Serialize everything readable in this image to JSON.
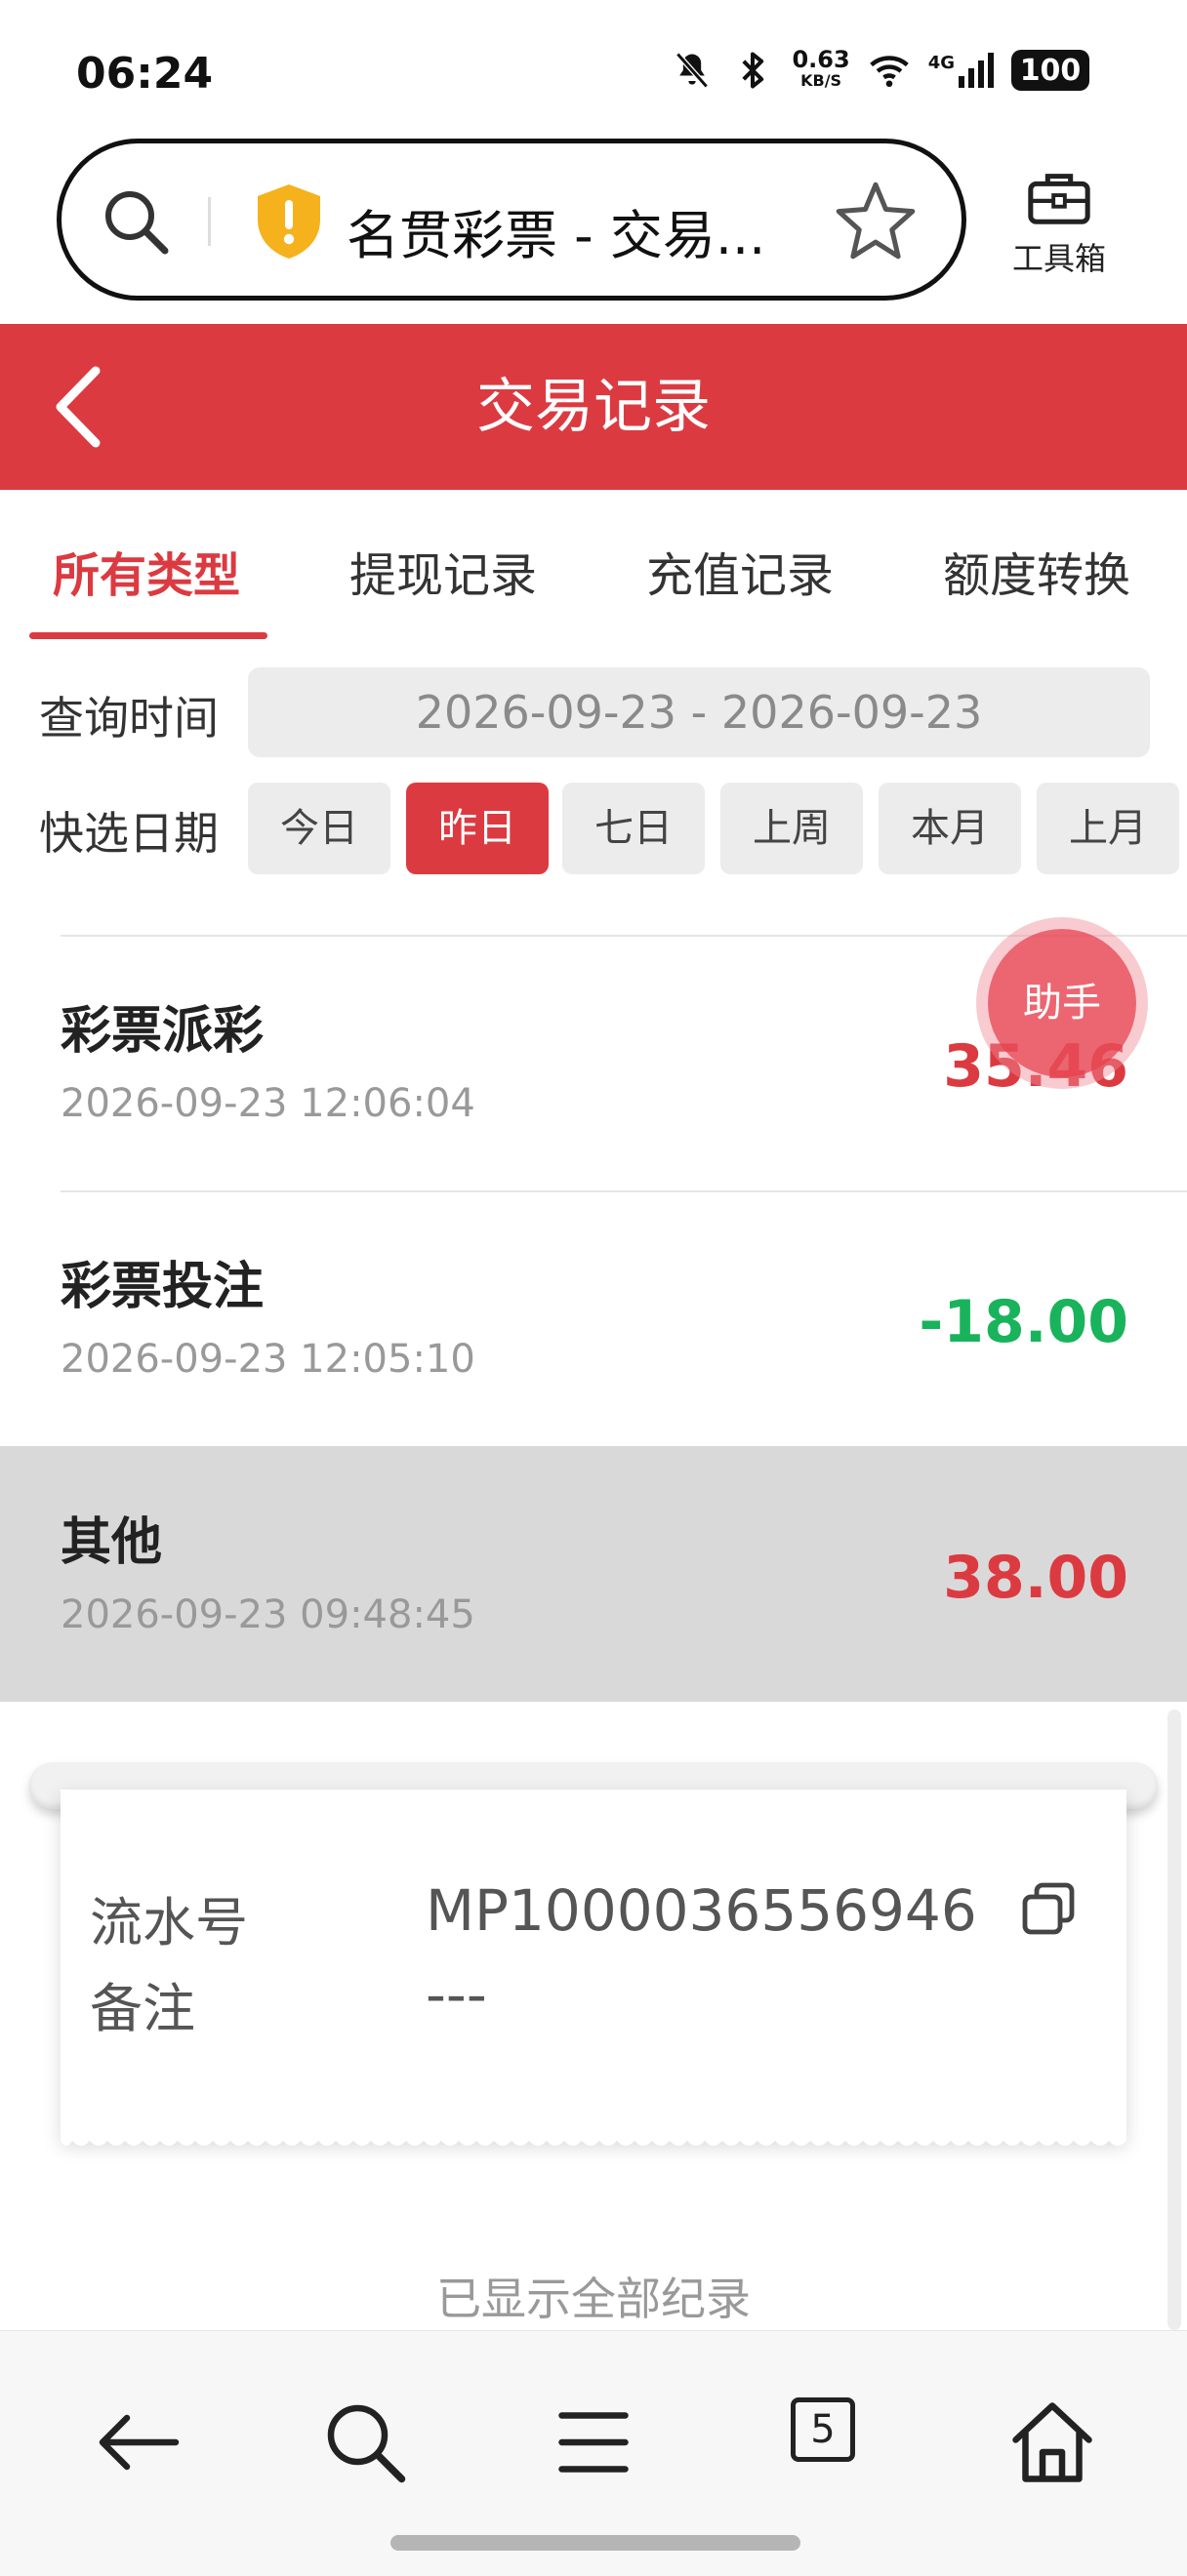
{
  "status_bar": {
    "time": "06:24",
    "net_speed": "0.63",
    "net_unit": "KB/S",
    "signal_label": "4G",
    "battery": "100",
    "icons": [
      "mute-icon",
      "bluetooth-icon",
      "wifi-icon",
      "cell-signal-icon"
    ]
  },
  "browser": {
    "page_title": "名贯彩票 - 交易...",
    "toolbox_label": "工具箱"
  },
  "header": {
    "title": "交易记录"
  },
  "tabs": [
    {
      "label": "所有类型",
      "active": true
    },
    {
      "label": "提现记录",
      "active": false
    },
    {
      "label": "充值记录",
      "active": false
    },
    {
      "label": "额度转换",
      "active": false
    }
  ],
  "filters": {
    "query_time_label": "查询时间",
    "date_range": "2026-09-23 - 2026-09-23",
    "quick_date_label": "快选日期",
    "quick_dates": [
      {
        "label": "今日",
        "active": false
      },
      {
        "label": "昨日",
        "active": true
      },
      {
        "label": "七日",
        "active": false
      },
      {
        "label": "上周",
        "active": false
      },
      {
        "label": "本月",
        "active": false
      },
      {
        "label": "上月",
        "active": false
      }
    ]
  },
  "records": [
    {
      "title": "彩票派彩",
      "time": "2026-09-23 12:06:04",
      "amount": "35.46",
      "amount_color": "#dc3a41"
    },
    {
      "title": "彩票投注",
      "time": "2026-09-23 12:05:10",
      "amount": "-18.00",
      "amount_color": "#19b35c"
    },
    {
      "title": "其他",
      "time": "2026-09-23 09:48:45",
      "amount": "38.00",
      "amount_color": "#dc3a41"
    }
  ],
  "assistant_label": "助手",
  "detail": {
    "serial_label": "流水号",
    "serial_value": "MP1000036556946",
    "note_label": "备注",
    "note_value": "---"
  },
  "end_text": "已显示全部纪录",
  "bottom_nav": {
    "tabs_count": "5"
  },
  "colors": {
    "brand_red": "#dc3a41",
    "positive_green": "#19b35c"
  }
}
